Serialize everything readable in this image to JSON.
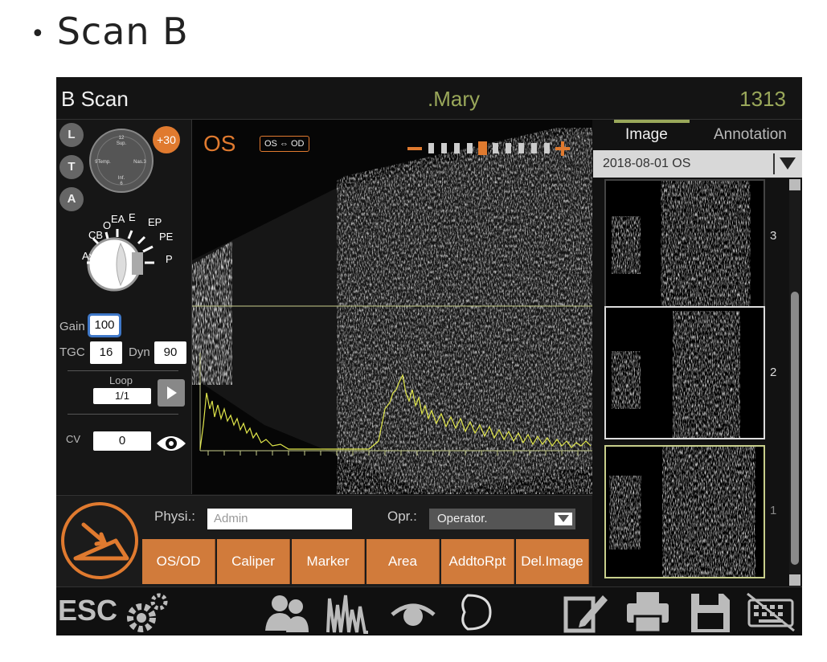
{
  "slide": {
    "bullet": "•",
    "title": "Scan B"
  },
  "header": {
    "title": "B Scan",
    "patient": ".Mary",
    "number": "1313"
  },
  "left_panel": {
    "buttons": [
      "L",
      "T",
      "A"
    ],
    "badge": "+30",
    "clock_labels": {
      "top_num": "12",
      "top": "Sup.",
      "left": "9Temp.",
      "right": "Nas.3",
      "bottom": "Inf.",
      "bottom_num": "6"
    },
    "eye_labels": [
      "O",
      "EA",
      "E",
      "EP",
      "CB",
      "PE",
      "Ax",
      "P"
    ],
    "gain_label": "Gain",
    "gain_value": "100",
    "tgc_label": "TGC",
    "tgc_value": "16",
    "dyn_label": "Dyn",
    "dyn_value": "90",
    "loop_label": "Loop",
    "loop_value": "1/1",
    "cv_label": "CV",
    "cv_value": "0"
  },
  "scan": {
    "eye": "OS",
    "toggle": "OS ⇔ OD",
    "minus": "−",
    "plus": "+"
  },
  "right_panel": {
    "tabs": [
      "Image",
      "Annotation"
    ],
    "date": "2018-08-01 OS",
    "thumbnails": [
      "3",
      "2",
      "1"
    ]
  },
  "controls": {
    "physician_label": "Physi.:",
    "physician_placeholder": "Admin",
    "operator_label": "Opr.:",
    "operator_value": "Operator.",
    "buttons": [
      "OS/OD",
      "Caliper",
      "Marker",
      "Area",
      "AddtoRpt",
      "Del.Image"
    ]
  },
  "toolbar": {
    "esc": "ESC",
    "icons": [
      "settings-icon",
      "patients-icon",
      "waveform-icon",
      "eye-icon",
      "lens-icon",
      "edit-icon",
      "print-icon",
      "save-icon",
      "keyboard-icon"
    ]
  },
  "colors": {
    "accent": "#e07a2f",
    "highlight": "#9aa85a",
    "button": "#d17b3b",
    "select": "#3f78c8"
  }
}
